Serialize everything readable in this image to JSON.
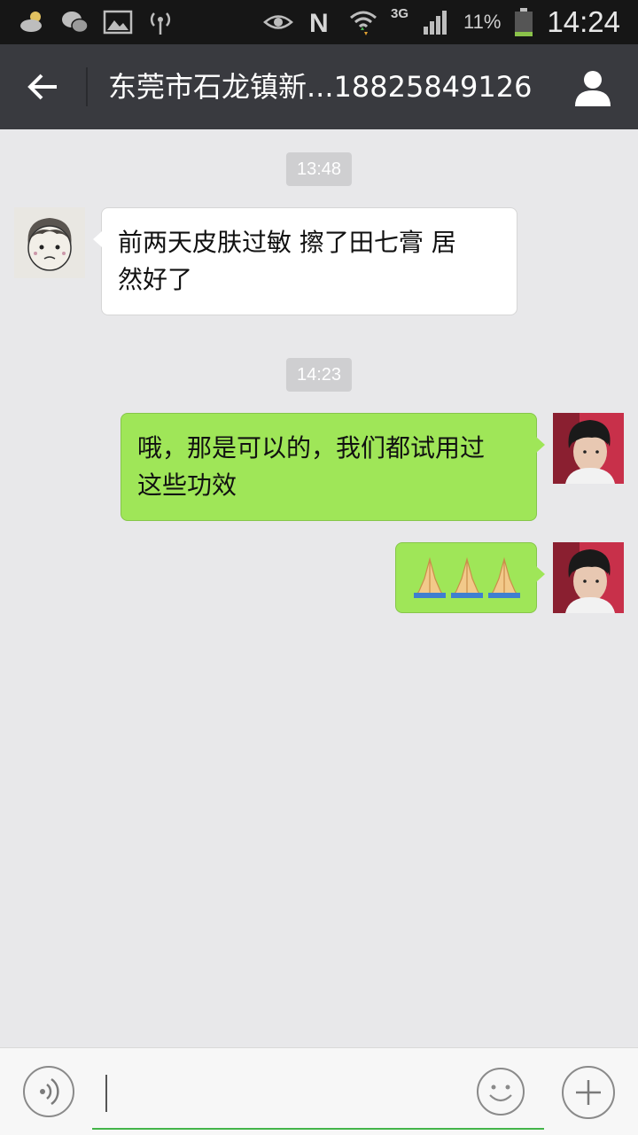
{
  "status_bar": {
    "battery_percent": "11%",
    "time": "14:24",
    "network": "3G",
    "icons": [
      "weather-icon",
      "wechat-icon",
      "gallery-icon",
      "signal-broadcast-icon",
      "eye-icon",
      "nfc-icon",
      "wifi-icon",
      "cell-signal-icon",
      "battery-icon"
    ]
  },
  "header": {
    "title": "东莞市石龙镇新...18825849126",
    "icons": [
      "back-arrow-icon",
      "profile-icon"
    ]
  },
  "messages": [
    {
      "type": "timestamp",
      "text": "13:48"
    },
    {
      "type": "message",
      "side": "left",
      "lines": [
        "前两天皮肤过敏 擦了田七膏 居",
        "然好了"
      ]
    },
    {
      "type": "timestamp",
      "text": "14:23"
    },
    {
      "type": "message",
      "side": "right",
      "lines": [
        "哦，那是可以的，我们都试用过",
        "这些功效"
      ]
    },
    {
      "type": "message",
      "side": "right",
      "emoji": "praying-hands-icon",
      "emoji_count": 3
    }
  ],
  "input_bar": {
    "value": "",
    "icons": [
      "voice-icon",
      "emoji-icon",
      "plus-icon"
    ]
  },
  "colors": {
    "status_bar_bg": "#161616",
    "title_bar_bg": "#393a3f",
    "chat_bg": "#e8e8ea",
    "sent_bubble": "#9fe658",
    "received_bubble": "#ffffff",
    "input_underline": "#44b549"
  }
}
